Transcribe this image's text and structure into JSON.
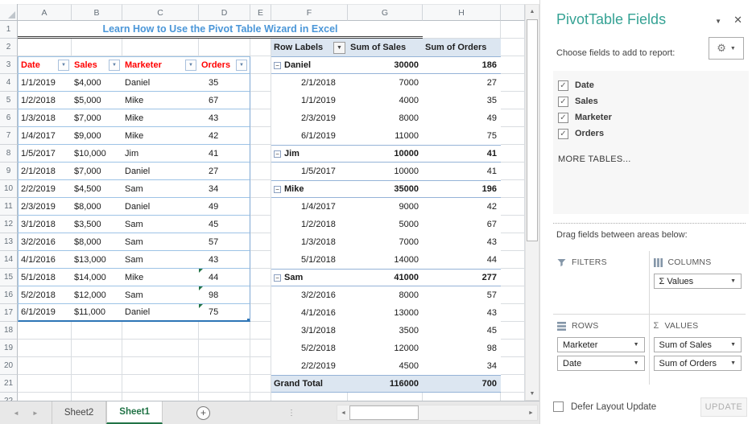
{
  "app": {
    "sheet_title": "Learn How to Use the Pivot Table Wizard in Excel"
  },
  "grid": {
    "columns": [
      "A",
      "B",
      "C",
      "D",
      "E",
      "F",
      "G",
      "H"
    ],
    "row_count": 22
  },
  "source_table": {
    "columns": [
      {
        "label": "Date"
      },
      {
        "label": "Sales"
      },
      {
        "label": "Marketer"
      },
      {
        "label": "Orders"
      }
    ],
    "rows": [
      {
        "date": "1/1/2019",
        "sales": "$4,000",
        "marketer": "Daniel",
        "orders": "35",
        "flag": false
      },
      {
        "date": "1/2/2018",
        "sales": "$5,000",
        "marketer": "Mike",
        "orders": "67",
        "flag": false
      },
      {
        "date": "1/3/2018",
        "sales": "$7,000",
        "marketer": "Mike",
        "orders": "43",
        "flag": false
      },
      {
        "date": "1/4/2017",
        "sales": "$9,000",
        "marketer": "Mike",
        "orders": "42",
        "flag": false
      },
      {
        "date": "1/5/2017",
        "sales": "$10,000",
        "marketer": "Jim",
        "orders": "41",
        "flag": false
      },
      {
        "date": "2/1/2018",
        "sales": "$7,000",
        "marketer": "Daniel",
        "orders": "27",
        "flag": false
      },
      {
        "date": "2/2/2019",
        "sales": "$4,500",
        "marketer": "Sam",
        "orders": "34",
        "flag": false
      },
      {
        "date": "2/3/2019",
        "sales": "$8,000",
        "marketer": "Daniel",
        "orders": "49",
        "flag": false
      },
      {
        "date": "3/1/2018",
        "sales": "$3,500",
        "marketer": "Sam",
        "orders": "45",
        "flag": false
      },
      {
        "date": "3/2/2016",
        "sales": "$8,000",
        "marketer": "Sam",
        "orders": "57",
        "flag": false
      },
      {
        "date": "4/1/2016",
        "sales": "$13,000",
        "marketer": "Sam",
        "orders": "43",
        "flag": false
      },
      {
        "date": "5/1/2018",
        "sales": "$14,000",
        "marketer": "Mike",
        "orders": "44",
        "flag": true
      },
      {
        "date": "5/2/2018",
        "sales": "$12,000",
        "marketer": "Sam",
        "orders": "98",
        "flag": true
      },
      {
        "date": "6/1/2019",
        "sales": "$11,000",
        "marketer": "Daniel",
        "orders": "75",
        "flag": true
      }
    ]
  },
  "pivot": {
    "headers": [
      "Row Labels",
      "Sum of Sales",
      "Sum of Orders"
    ],
    "rows": [
      {
        "label": "Daniel",
        "sales": "30000",
        "orders": "186",
        "type": "group"
      },
      {
        "label": "2/1/2018",
        "sales": "7000",
        "orders": "27",
        "type": "detail"
      },
      {
        "label": "1/1/2019",
        "sales": "4000",
        "orders": "35",
        "type": "detail"
      },
      {
        "label": "2/3/2019",
        "sales": "8000",
        "orders": "49",
        "type": "detail"
      },
      {
        "label": "6/1/2019",
        "sales": "11000",
        "orders": "75",
        "type": "detail"
      },
      {
        "label": "Jim",
        "sales": "10000",
        "orders": "41",
        "type": "group"
      },
      {
        "label": "1/5/2017",
        "sales": "10000",
        "orders": "41",
        "type": "detail"
      },
      {
        "label": "Mike",
        "sales": "35000",
        "orders": "196",
        "type": "group"
      },
      {
        "label": "1/4/2017",
        "sales": "9000",
        "orders": "42",
        "type": "detail"
      },
      {
        "label": "1/2/2018",
        "sales": "5000",
        "orders": "67",
        "type": "detail"
      },
      {
        "label": "1/3/2018",
        "sales": "7000",
        "orders": "43",
        "type": "detail"
      },
      {
        "label": "5/1/2018",
        "sales": "14000",
        "orders": "44",
        "type": "detail"
      },
      {
        "label": "Sam",
        "sales": "41000",
        "orders": "277",
        "type": "group"
      },
      {
        "label": "3/2/2016",
        "sales": "8000",
        "orders": "57",
        "type": "detail"
      },
      {
        "label": "4/1/2016",
        "sales": "13000",
        "orders": "43",
        "type": "detail"
      },
      {
        "label": "3/1/2018",
        "sales": "3500",
        "orders": "45",
        "type": "detail"
      },
      {
        "label": "5/2/2018",
        "sales": "12000",
        "orders": "98",
        "type": "detail"
      },
      {
        "label": "2/2/2019",
        "sales": "4500",
        "orders": "34",
        "type": "detail"
      },
      {
        "label": "Grand Total",
        "sales": "116000",
        "orders": "700",
        "type": "total"
      }
    ]
  },
  "tab_bar": {
    "tabs": [
      {
        "label": "Sheet2",
        "active": false
      },
      {
        "label": "Sheet1",
        "active": true
      }
    ]
  },
  "fields_pane": {
    "title": "PivotTable Fields",
    "choose_label": "Choose fields to add to report:",
    "fields": [
      {
        "label": "Date",
        "checked": true
      },
      {
        "label": "Sales",
        "checked": true
      },
      {
        "label": "Marketer",
        "checked": true
      },
      {
        "label": "Orders",
        "checked": true
      }
    ],
    "more_tables": "MORE TABLES...",
    "drag_label": "Drag fields between areas below:",
    "areas": {
      "filters": {
        "label": "FILTERS",
        "items": []
      },
      "columns": {
        "label": "COLUMNS",
        "items": [
          "Σ Values"
        ]
      },
      "rows": {
        "label": "ROWS",
        "items": [
          "Marketer",
          "Date"
        ]
      },
      "values": {
        "label": "VALUES",
        "items": [
          "Sum of Sales",
          "Sum of Orders"
        ]
      }
    },
    "defer_label": "Defer Layout Update",
    "update_label": "UPDATE"
  },
  "icons": {
    "dropdown": "▼",
    "close": "✕",
    "gear": "⚙",
    "check": "✓",
    "collapse": "−",
    "sigma": "Σ",
    "scroll_up": "▲",
    "scroll_down": "▼",
    "scroll_left": "◄",
    "scroll_right": "►",
    "tab_prev": "◄",
    "tab_next": "►",
    "add_sheet": "+",
    "dots": "⋮"
  },
  "colors": {
    "accent_green": "#217346",
    "pane_title": "#35a294",
    "title_blue": "#4a96d8",
    "header_red": "#ff0000",
    "pivot_header_bg": "#dce6f1",
    "pivot_border": "#95b3d7",
    "table_border": "#9dc3e6",
    "table_outer": "#2e75b6",
    "grid_line": "#d9dde1",
    "flag_green": "#217346"
  }
}
